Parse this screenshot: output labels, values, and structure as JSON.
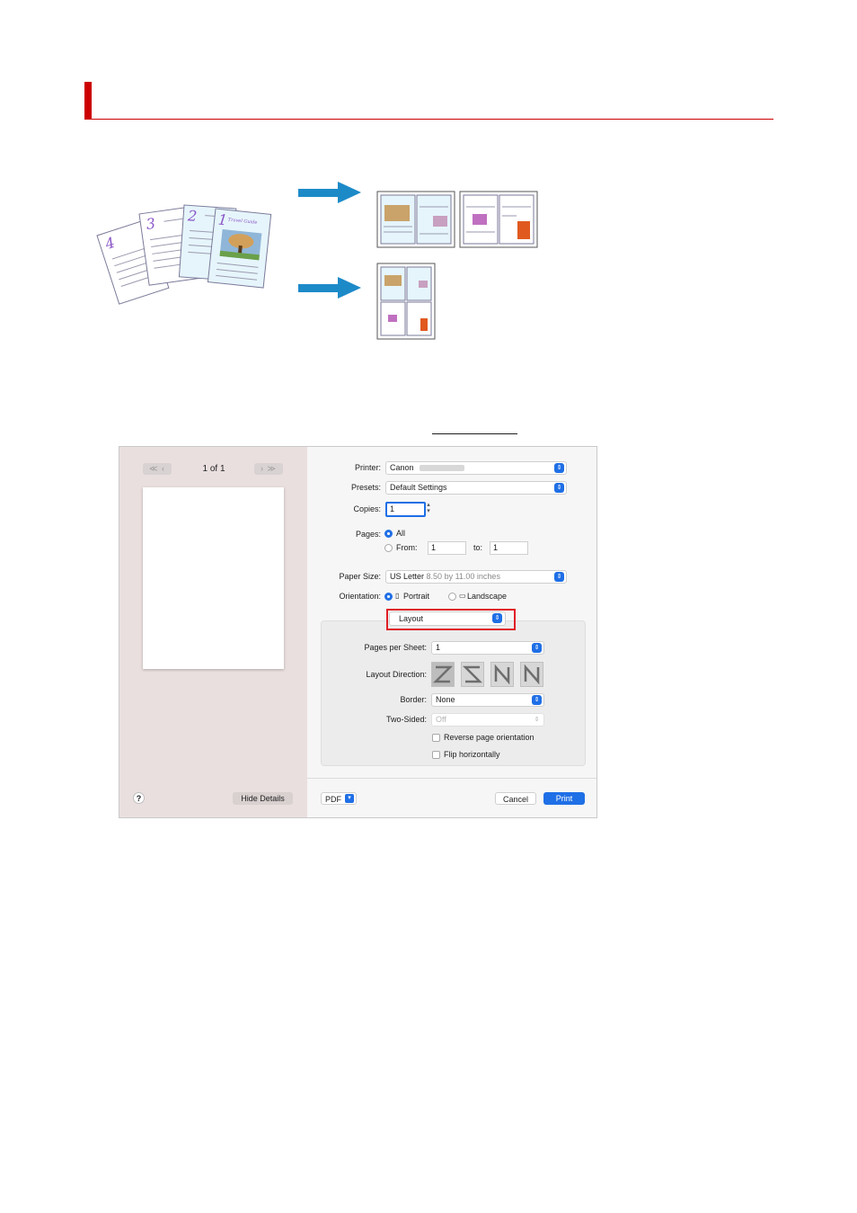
{
  "dialog": {
    "navigation": {
      "first_prev": "≪ ‹",
      "next_last": "› ≫",
      "page_count": "1 of 1"
    },
    "help_label": "?",
    "hide_details_label": "Hide Details",
    "printer": {
      "label": "Printer:",
      "value": "Canon"
    },
    "presets": {
      "label": "Presets:",
      "value": "Default Settings"
    },
    "copies": {
      "label": "Copies:",
      "value": "1"
    },
    "pages": {
      "label": "Pages:",
      "all_label": "All",
      "from_label": "From:",
      "from_value": "1",
      "to_label": "to:",
      "to_value": "1"
    },
    "paper_size": {
      "label": "Paper Size:",
      "value": "US Letter",
      "detail": "8.50 by 11.00 inches"
    },
    "orientation": {
      "label": "Orientation:",
      "portrait_label": "Portrait",
      "landscape_label": "Landscape"
    },
    "section_select": {
      "value": "Layout"
    },
    "layout": {
      "pages_per_sheet": {
        "label": "Pages per Sheet:",
        "value": "1"
      },
      "layout_direction": {
        "label": "Layout Direction:"
      },
      "border": {
        "label": "Border:",
        "value": "None"
      },
      "two_sided": {
        "label": "Two-Sided:",
        "value": "Off"
      },
      "reverse_label": "Reverse page orientation",
      "flip_label": "Flip horizontally"
    },
    "pdf_label": "PDF",
    "cancel_label": "Cancel",
    "print_label": "Print"
  },
  "illustration": {
    "page_numbers": [
      "4",
      "3",
      "2",
      "1"
    ],
    "heading_text": "Travel Guide"
  },
  "colors": {
    "accent": "#1f6fe6",
    "heading_red": "#cc0000",
    "highlight_red": "#e01e26",
    "arrow_blue": "#1d8ac8",
    "preview_bg": "#eadfdf"
  }
}
